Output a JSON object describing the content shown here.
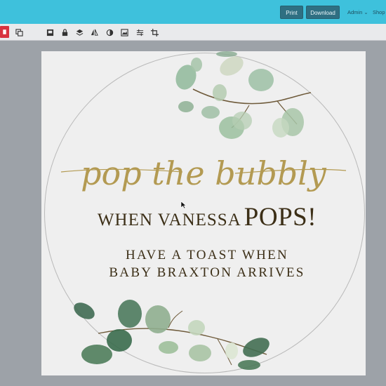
{
  "topbar": {
    "print_label": "Print",
    "download_label": "Download",
    "admin_label": "Admin ⌄",
    "shop_label": "Shop"
  },
  "toolbar": {
    "tools": [
      "delete-icon",
      "copy-icon",
      "paste-icon",
      "lock-icon",
      "layers-icon",
      "flip-icon",
      "contrast-icon",
      "image-icon",
      "align-icon",
      "crop-icon"
    ]
  },
  "design": {
    "script_title": "pop the bubbly",
    "line_when": "WHEN VANESSA",
    "line_pops": "POPS!",
    "line_toast_1": "HAVE A TOAST WHEN",
    "line_toast_2": "BABY BRAXTON ARRIVES"
  },
  "colors": {
    "topbar": "#3ec1dc",
    "gold": "#b39a52",
    "text_dark": "#3c2f17"
  }
}
